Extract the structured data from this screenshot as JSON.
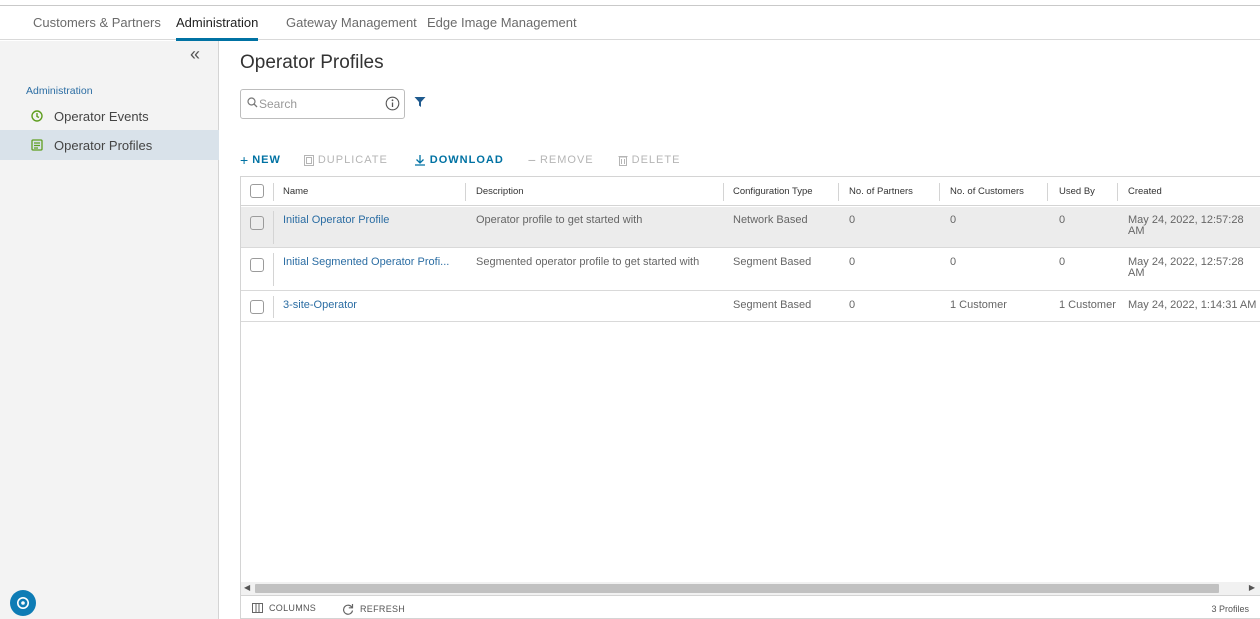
{
  "topnav": {
    "tabs": [
      {
        "label": "Customers & Partners"
      },
      {
        "label": "Administration"
      },
      {
        "label": "Gateway Management"
      },
      {
        "label": "Edge Image Management"
      }
    ]
  },
  "sidebar": {
    "collapse_icon": "double-chevron-left-icon",
    "heading": "Administration",
    "items": [
      {
        "label": "Operator Events",
        "icon": "events-icon",
        "color": "#5f9e1f"
      },
      {
        "label": "Operator Profiles",
        "icon": "profiles-icon",
        "color": "#5f9e1f"
      }
    ]
  },
  "main": {
    "title": "Operator Profiles",
    "search": {
      "placeholder": "Search",
      "value": ""
    },
    "toolbar": {
      "new": "NEW",
      "duplicate": "DUPLICATE",
      "download": "DOWNLOAD",
      "remove": "REMOVE",
      "delete": "DELETE"
    },
    "table": {
      "columns": [
        "Name",
        "Description",
        "Configuration Type",
        "No. of Partners",
        "No. of Customers",
        "Used By",
        "Created"
      ],
      "rows": [
        {
          "name": "Initial Operator Profile",
          "description": "Operator profile to get started with",
          "config_type": "Network Based",
          "partners": "0",
          "customers": "0",
          "used_by": "0",
          "created": "May 24, 2022, 12:57:28 AM"
        },
        {
          "name": "Initial Segmented Operator Profi...",
          "description": "Segmented operator profile to get started with",
          "config_type": "Segment Based",
          "partners": "0",
          "customers": "0",
          "used_by": "0",
          "created": "May 24, 2022, 12:57:28 AM"
        },
        {
          "name": "3-site-Operator",
          "description": "",
          "config_type": "Segment Based",
          "partners": "0",
          "customers": "1 Customer",
          "used_by": "1 Customer",
          "created": "May 24, 2022, 1:14:31 AM"
        }
      ]
    },
    "footer": {
      "columns": "COLUMNS",
      "refresh": "REFRESH",
      "count": "3 Profiles"
    }
  },
  "colors": {
    "accent": "#0072a3",
    "link": "#2b6da3",
    "selected_row": "#ececec",
    "sidebar_selected": "#d9e2ea"
  }
}
